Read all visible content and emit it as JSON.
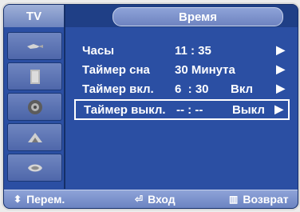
{
  "tab": {
    "label": "TV"
  },
  "header": {
    "title": "Время"
  },
  "menu": {
    "rows": [
      {
        "label": "Часы",
        "value": "11 : 35",
        "state": "",
        "arrow": "▶"
      },
      {
        "label": "Таймер сна",
        "value": "30 Минута",
        "state": "",
        "arrow": "▶"
      },
      {
        "label": "Таймер вкл.",
        "value": "6  : 30",
        "state": "Вкл",
        "arrow": "▶"
      },
      {
        "label": "Таймер выкл.",
        "value": "-- : --",
        "state": "Выкл",
        "arrow": "▶"
      }
    ]
  },
  "footer": {
    "move_icon": "up-down-arrows-icon",
    "move_label": "Перем.",
    "enter_icon": "enter-icon",
    "enter_label": "Вход",
    "return_icon": "return-icon",
    "return_label": "Возврат"
  },
  "sidebar": {
    "items": [
      {
        "icon": "picture-icon"
      },
      {
        "icon": "sound-icon"
      },
      {
        "icon": "channel-icon"
      },
      {
        "icon": "setup-icon"
      },
      {
        "icon": "input-icon"
      }
    ]
  }
}
